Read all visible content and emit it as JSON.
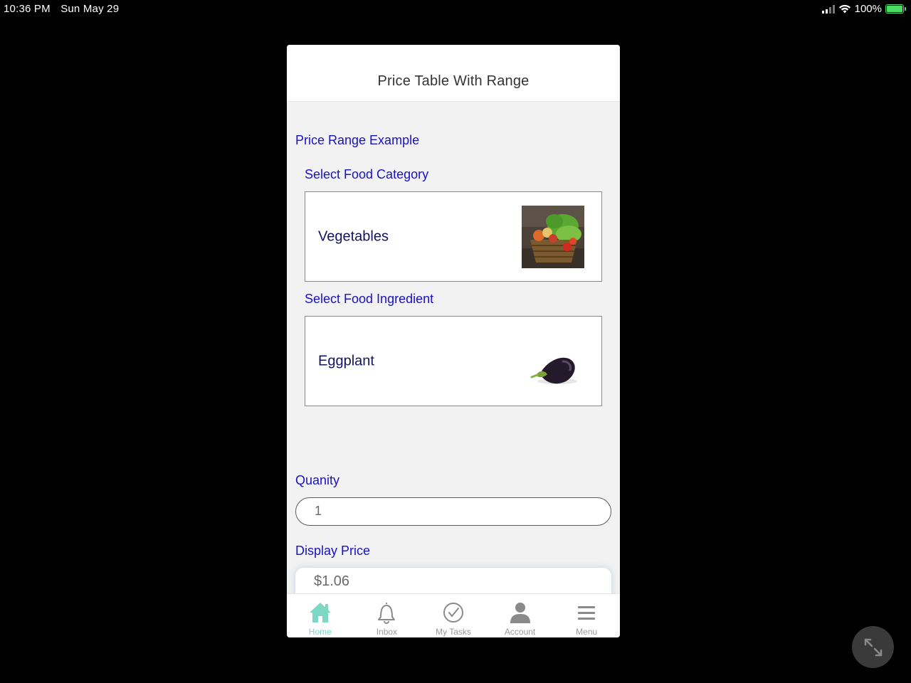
{
  "status_bar": {
    "time": "10:36 PM",
    "date": "Sun May 29",
    "battery": "100%"
  },
  "header": {
    "title": "Price Table With Range"
  },
  "form": {
    "section_title": "Price Range Example",
    "category_label": "Select Food Category",
    "category_value": "Vegetables",
    "ingredient_label": "Select Food Ingredient",
    "ingredient_value": "Eggplant",
    "quantity_label": "Quanity",
    "quantity_value": "1",
    "price_label": "Display Price",
    "price_value": "$1.06"
  },
  "tabbar": {
    "items": [
      {
        "label": "Home",
        "icon": "home-icon",
        "active": true
      },
      {
        "label": "Inbox",
        "icon": "bell-icon"
      },
      {
        "label": "My Tasks",
        "icon": "check-circle-icon"
      },
      {
        "label": "Account",
        "icon": "person-icon"
      },
      {
        "label": "Menu",
        "icon": "hamburger-icon"
      }
    ]
  },
  "colors": {
    "accent": "#7ed6c4",
    "label_blue": "#1a10c8",
    "background": "#f2f2f2"
  }
}
